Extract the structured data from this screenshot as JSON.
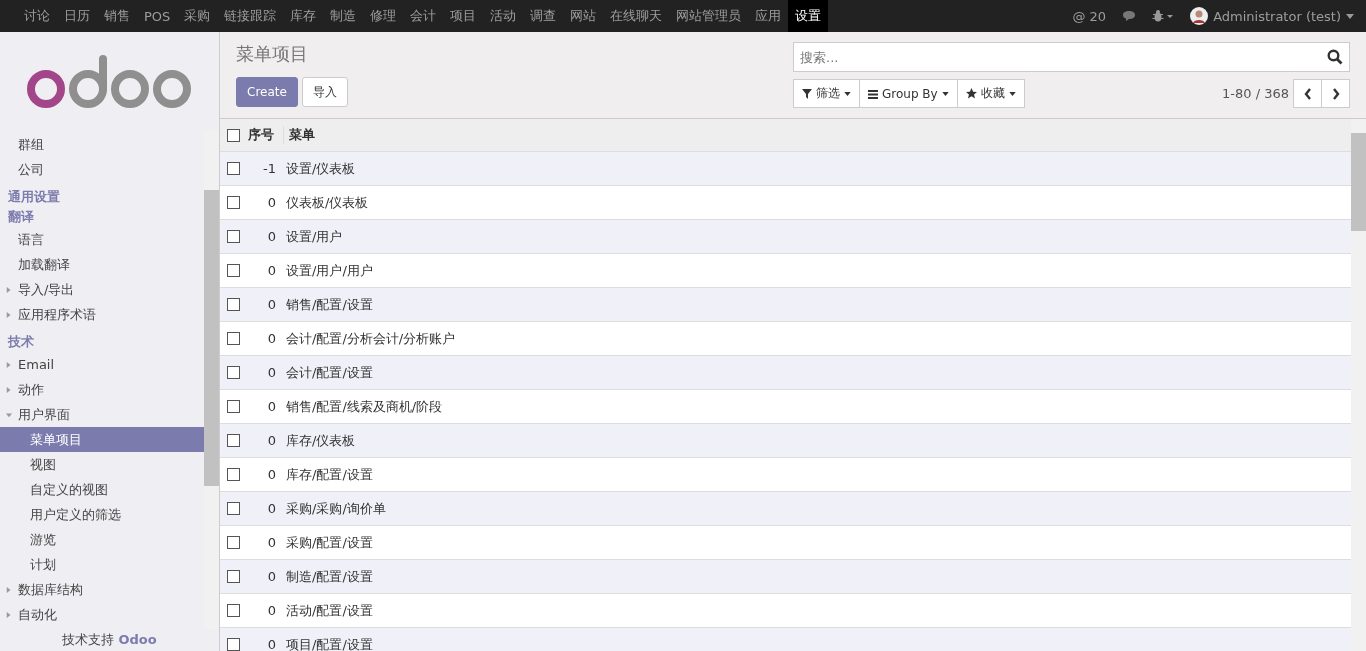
{
  "topbar": {
    "apps": [
      {
        "label": "讨论",
        "selected": false
      },
      {
        "label": "日历",
        "selected": false
      },
      {
        "label": "销售",
        "selected": false
      },
      {
        "label": "POS",
        "selected": false
      },
      {
        "label": "采购",
        "selected": false
      },
      {
        "label": "链接跟踪",
        "selected": false
      },
      {
        "label": "库存",
        "selected": false
      },
      {
        "label": "制造",
        "selected": false
      },
      {
        "label": "修理",
        "selected": false
      },
      {
        "label": "会计",
        "selected": false
      },
      {
        "label": "项目",
        "selected": false
      },
      {
        "label": "活动",
        "selected": false
      },
      {
        "label": "调查",
        "selected": false
      },
      {
        "label": "网站",
        "selected": false
      },
      {
        "label": "在线聊天",
        "selected": false
      },
      {
        "label": "网站管理员",
        "selected": false
      },
      {
        "label": "应用",
        "selected": false
      },
      {
        "label": "设置",
        "selected": true
      }
    ],
    "mentions": "@ 20",
    "user": "Administrator (test)"
  },
  "sidebar": {
    "items": [
      {
        "kind": "leaf",
        "label": "群组",
        "selected": false
      },
      {
        "kind": "leaf",
        "label": "公司",
        "selected": false
      },
      {
        "kind": "heading",
        "label": "通用设置"
      },
      {
        "kind": "heading",
        "label": "翻译"
      },
      {
        "kind": "leaf",
        "label": "语言",
        "selected": false
      },
      {
        "kind": "leaf",
        "label": "加载翻译",
        "selected": false
      },
      {
        "kind": "folder",
        "label": "导入/导出",
        "expanded": false
      },
      {
        "kind": "folder",
        "label": "应用程序术语",
        "expanded": false
      },
      {
        "kind": "heading",
        "label": "技术"
      },
      {
        "kind": "folder",
        "label": "Email",
        "expanded": false
      },
      {
        "kind": "folder",
        "label": "动作",
        "expanded": false
      },
      {
        "kind": "folder",
        "label": "用户界面",
        "expanded": true,
        "children": [
          {
            "label": "菜单项目",
            "selected": true
          },
          {
            "label": "视图",
            "selected": false
          },
          {
            "label": "自定义的视图",
            "selected": false
          },
          {
            "label": "用户定义的筛选",
            "selected": false
          },
          {
            "label": "游览",
            "selected": false
          },
          {
            "label": "计划",
            "selected": false
          }
        ]
      },
      {
        "kind": "folder",
        "label": "数据库结构",
        "expanded": false
      },
      {
        "kind": "folder",
        "label": "自动化",
        "expanded": false
      }
    ],
    "footer_prefix": "技术支持",
    "footer_brand": "Odoo"
  },
  "control_panel": {
    "title": "菜单项目",
    "create_button": "Create",
    "import_button": "导入",
    "search": {
      "placeholder": "搜索..."
    },
    "filters": [
      "筛选",
      "Group By",
      "收藏"
    ],
    "pager": "1-80 / 368"
  },
  "table": {
    "all_selected": false,
    "columns": [
      "序号",
      "菜单"
    ],
    "rows": [
      {
        "sequence": "-1",
        "menu": "设置/仪表板",
        "checked": false
      },
      {
        "sequence": "0",
        "menu": "仪表板/仪表板",
        "checked": false
      },
      {
        "sequence": "0",
        "menu": "设置/用户",
        "checked": false
      },
      {
        "sequence": "0",
        "menu": "设置/用户/用户",
        "checked": false
      },
      {
        "sequence": "0",
        "menu": "销售/配置/设置",
        "checked": false
      },
      {
        "sequence": "0",
        "menu": "会计/配置/分析会计/分析账户",
        "checked": false
      },
      {
        "sequence": "0",
        "menu": "会计/配置/设置",
        "checked": false
      },
      {
        "sequence": "0",
        "menu": "销售/配置/线索及商机/阶段",
        "checked": false
      },
      {
        "sequence": "0",
        "menu": "库存/仪表板",
        "checked": false
      },
      {
        "sequence": "0",
        "menu": "库存/配置/设置",
        "checked": false
      },
      {
        "sequence": "0",
        "menu": "采购/采购/询价单",
        "checked": false
      },
      {
        "sequence": "0",
        "menu": "采购/配置/设置",
        "checked": false
      },
      {
        "sequence": "0",
        "menu": "制造/配置/设置",
        "checked": false
      },
      {
        "sequence": "0",
        "menu": "活动/配置/设置",
        "checked": false
      },
      {
        "sequence": "0",
        "menu": "项目/配置/设置",
        "checked": false
      }
    ]
  }
}
